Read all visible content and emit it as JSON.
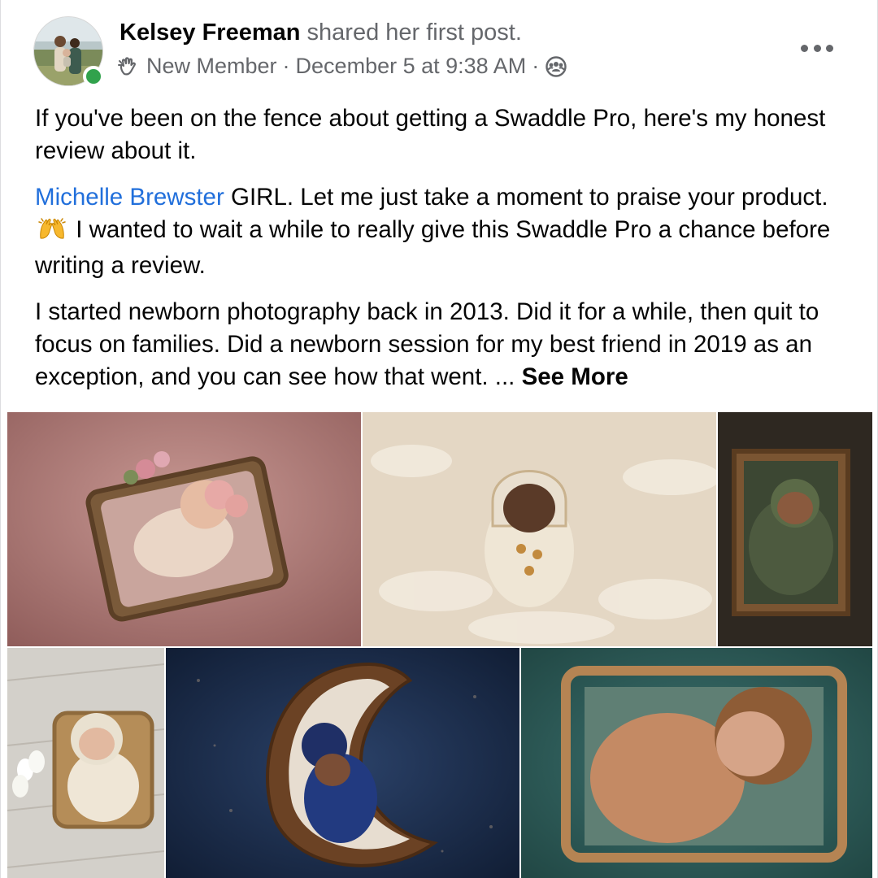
{
  "post": {
    "author": "Kelsey Freeman",
    "action": "shared her first post.",
    "badge": "New Member",
    "timestamp": "December 5 at 9:38 AM",
    "separator": "·",
    "badge_icon": "waving-hand-icon",
    "audience_icon": "group-audience-icon",
    "more_icon": "more-options-icon",
    "online_color": "#31a24c",
    "mention_color": "#216fdb",
    "paragraphs": {
      "p1": "If you've been on the fence about getting a Swaddle Pro, here's my honest review about it.",
      "p2_mention": "Michelle Brewster",
      "p2_text_a": " GIRL. Let me just take a moment to praise your product.",
      "p2_emoji": "raising-hands-emoji",
      "p2_text_b": " I wanted to wait a while to really give this Swaddle Pro a chance before writing a review.",
      "p3": "I started newborn photography back in 2013. Did it for a while, then quit to focus on families. Did a newborn session for my best friend in 2019 as an exception, and you can see how that went. ... ",
      "see_more": "See More"
    }
  },
  "photos": [
    {
      "name": "newborn-pink-basket-photo",
      "palette": [
        "#b07a78",
        "#e9cdbe",
        "#8a6a44"
      ]
    },
    {
      "name": "newborn-cream-fur-photo",
      "palette": [
        "#e8dccb",
        "#f4ede2",
        "#3d2a1f"
      ]
    },
    {
      "name": "newborn-green-crate-photo",
      "palette": [
        "#2b261f",
        "#4d5a3f",
        "#7a5532"
      ]
    },
    {
      "name": "newborn-white-bonnet-photo",
      "palette": [
        "#d9d6d0",
        "#efe6d6",
        "#a9834d"
      ]
    },
    {
      "name": "newborn-moon-bowl-photo",
      "palette": [
        "#1d2f4e",
        "#6b4224",
        "#223a80"
      ]
    },
    {
      "name": "newborn-rattan-bed-photo",
      "palette": [
        "#2d5e5a",
        "#c48a64",
        "#a97e4f"
      ]
    }
  ]
}
